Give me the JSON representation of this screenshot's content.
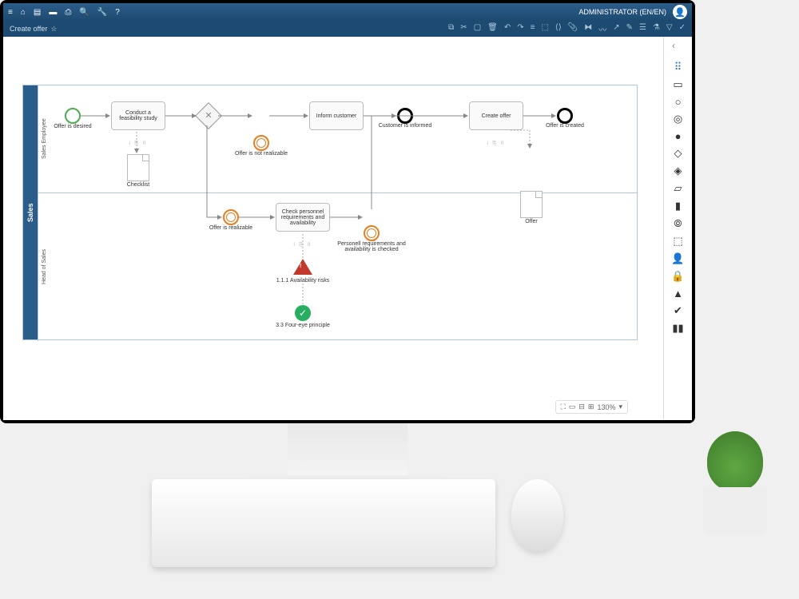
{
  "header": {
    "user": "ADMINISTRATOR (EN/EN)"
  },
  "breadcrumb": {
    "title": "Create offer"
  },
  "pool": {
    "name": "Sales",
    "lane1": "Sales Employee",
    "lane2": "Head of Sales"
  },
  "nodes": {
    "start": "Offer is desired",
    "feasibility": "Conduct a feasibility study",
    "checklist": "Checklist",
    "not_realizable": "Offer is not realizable",
    "inform": "Inform customer",
    "informed": "Customer is informed",
    "create": "Create offer",
    "created": "Offer is created",
    "offer_doc": "Offer",
    "realizable": "Offer is realizable",
    "check_personnel": "Check personnel requirements and availability",
    "checked": "Personell requirements and availability is checked",
    "risk": "1.1.1 Availability risks",
    "principle": "3.3 Four-eye principle"
  },
  "zoom": {
    "level": "130%"
  }
}
